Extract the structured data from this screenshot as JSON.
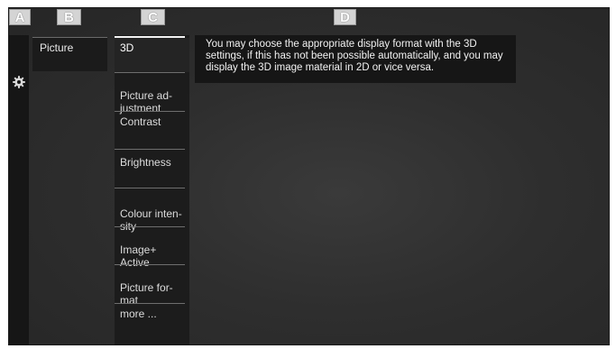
{
  "labels": {
    "a": "A",
    "b": "B",
    "c": "C",
    "d": "D"
  },
  "icons": {
    "settings": "gear-icon"
  },
  "menu_b": {
    "picture": "Picture"
  },
  "menu_c": {
    "items": [
      {
        "label": "3D"
      },
      {
        "label": "Picture ad-\njustment"
      },
      {
        "label": "Contrast"
      },
      {
        "label": "Brightness"
      },
      {
        "label": "Colour inten-\nsity"
      },
      {
        "label": "Image+\nActive"
      },
      {
        "label": "Picture for-\nmat"
      },
      {
        "label": "more ..."
      }
    ]
  },
  "info": {
    "text": "You may choose the appropriate display format with the 3D settings, if this has not been possible automatically, and you may display the 3D image material in 2D or vice versa."
  },
  "colors": {
    "highlight": "#f2f2f2",
    "background": "#2e2e2e",
    "panel": "#1c1c1c"
  }
}
